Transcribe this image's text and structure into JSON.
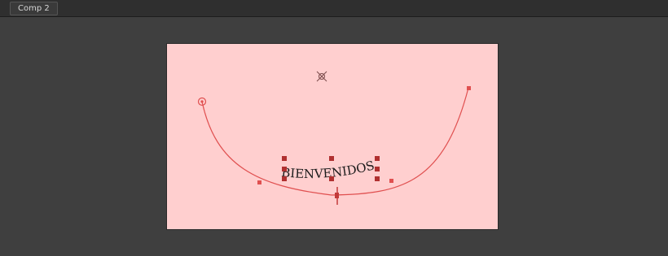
{
  "tab": {
    "label": "Comp 2"
  },
  "composition": {
    "background_color": "#ffcfcf",
    "path_color": "#e05050",
    "text_layer": {
      "text": "BIENVENIDOS"
    }
  }
}
